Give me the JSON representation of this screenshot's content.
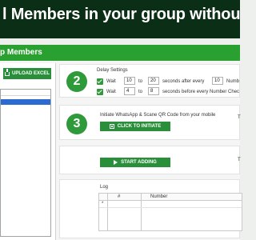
{
  "banner": {
    "title": "l Members in your group without saving"
  },
  "window": {
    "title": "p Members"
  },
  "left_panel": {
    "upload_button_label": "UPLOAD EXCEL",
    "upload_icon": "upload-icon"
  },
  "delay": {
    "step": "2",
    "heading": "Delay Settings",
    "row1": {
      "checked": true,
      "label_wait": "Wait",
      "from": "10",
      "label_to": "to",
      "to": "20",
      "label_after": "seconds after every",
      "every": "10",
      "label_tail": "Numb"
    },
    "row2": {
      "checked": true,
      "label_wait": "Wait",
      "from": "4",
      "label_to": "to",
      "to": "8",
      "label_after": "seconds before every Number Chec"
    }
  },
  "whatsapp": {
    "step": "3",
    "heading": "Initiate WhatsApp & Scane QR Code from your mobile",
    "button_label": "CLICK TO INITIATE",
    "icon": "qr-icon",
    "side_mark": "T"
  },
  "start": {
    "button_label": "START ADDING",
    "icon": "play-icon",
    "side_mark": "T"
  },
  "log": {
    "heading": "Log",
    "columns": [
      "#",
      "Number"
    ],
    "row_marker": "*"
  },
  "colors": {
    "banner": "#0b2e16",
    "accent": "#29a02f",
    "button": "#2a8f3b",
    "selection": "#2b6bd1"
  }
}
